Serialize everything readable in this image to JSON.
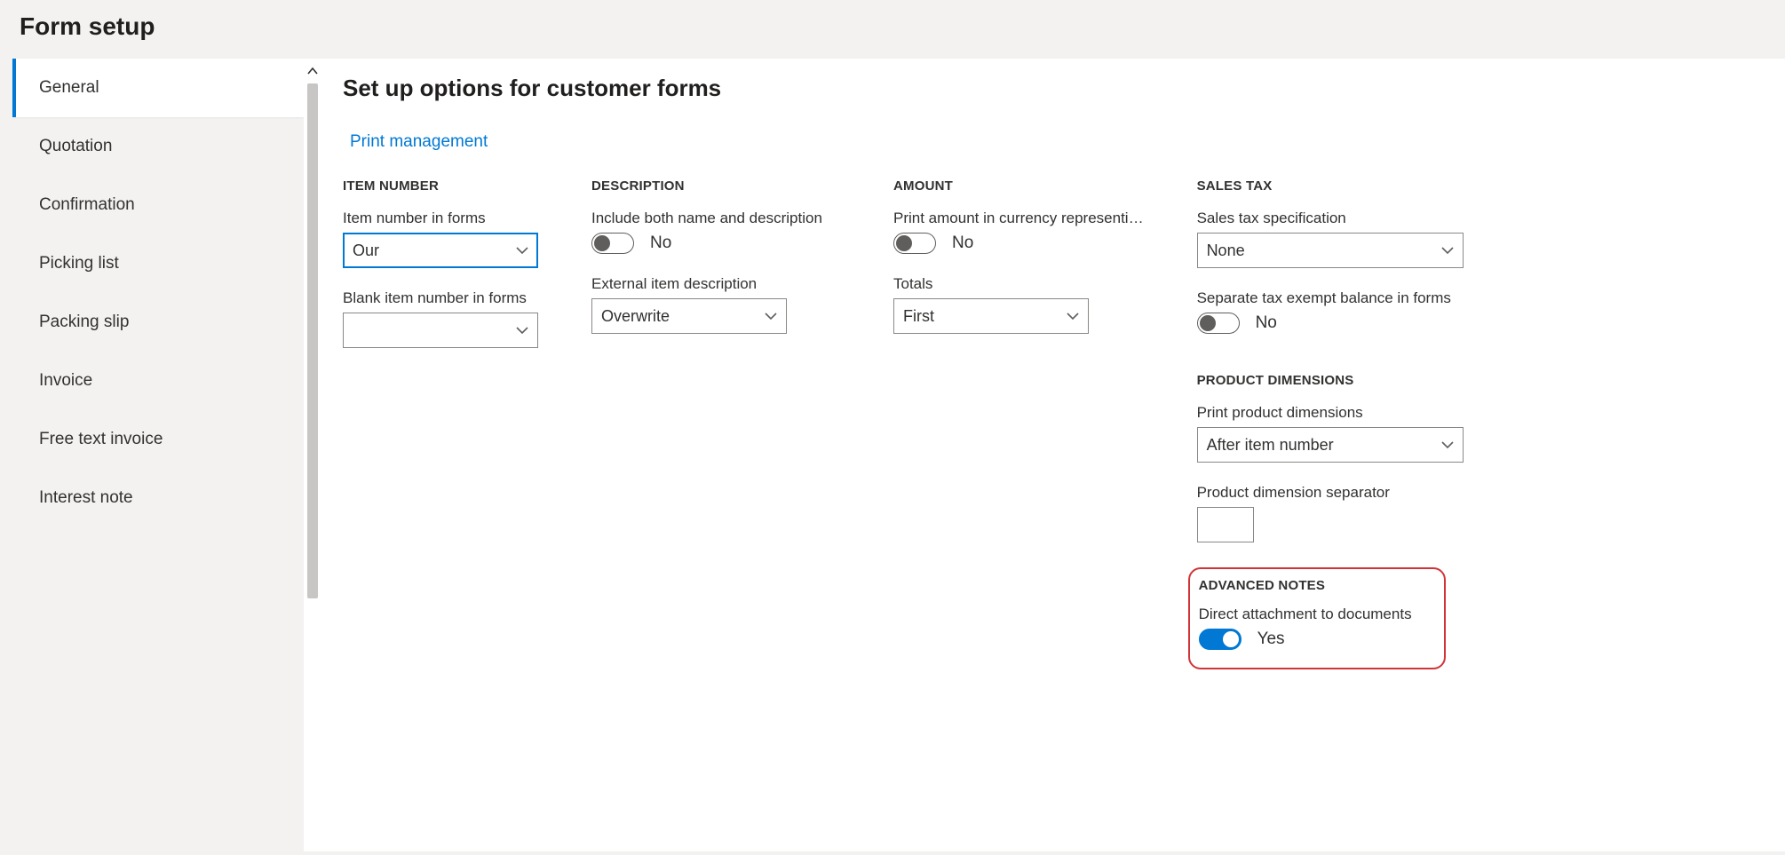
{
  "page_title": "Form setup",
  "sidebar": {
    "items": [
      {
        "label": "General",
        "active": true
      },
      {
        "label": "Quotation",
        "active": false
      },
      {
        "label": "Confirmation",
        "active": false
      },
      {
        "label": "Picking list",
        "active": false
      },
      {
        "label": "Packing slip",
        "active": false
      },
      {
        "label": "Invoice",
        "active": false
      },
      {
        "label": "Free text invoice",
        "active": false
      },
      {
        "label": "Interest note",
        "active": false
      }
    ]
  },
  "main": {
    "title": "Set up options for customer forms",
    "link": "Print management",
    "sections": {
      "item_number": {
        "head": "ITEM NUMBER",
        "item_number_in_forms": {
          "label": "Item number in forms",
          "value": "Our"
        },
        "blank_item_number": {
          "label": "Blank item number in forms",
          "value": ""
        }
      },
      "description": {
        "head": "DESCRIPTION",
        "include_both": {
          "label": "Include both name and description",
          "value": "No",
          "on": false
        },
        "ext_item_desc": {
          "label": "External item description",
          "value": "Overwrite"
        }
      },
      "amount": {
        "head": "AMOUNT",
        "print_amount": {
          "label": "Print amount in currency representi…",
          "value": "No",
          "on": false
        },
        "totals": {
          "label": "Totals",
          "value": "First"
        }
      },
      "sales_tax": {
        "head": "SALES TAX",
        "spec": {
          "label": "Sales tax specification",
          "value": "None"
        },
        "sep_exempt": {
          "label": "Separate tax exempt balance in forms",
          "value": "No",
          "on": false
        }
      },
      "product_dimensions": {
        "head": "PRODUCT DIMENSIONS",
        "print_dims": {
          "label": "Print product dimensions",
          "value": "After item number"
        },
        "separator": {
          "label": "Product dimension separator",
          "value": ""
        }
      },
      "advanced_notes": {
        "head": "ADVANCED NOTES",
        "direct_attach": {
          "label": "Direct attachment to documents",
          "value": "Yes",
          "on": true
        }
      }
    }
  }
}
